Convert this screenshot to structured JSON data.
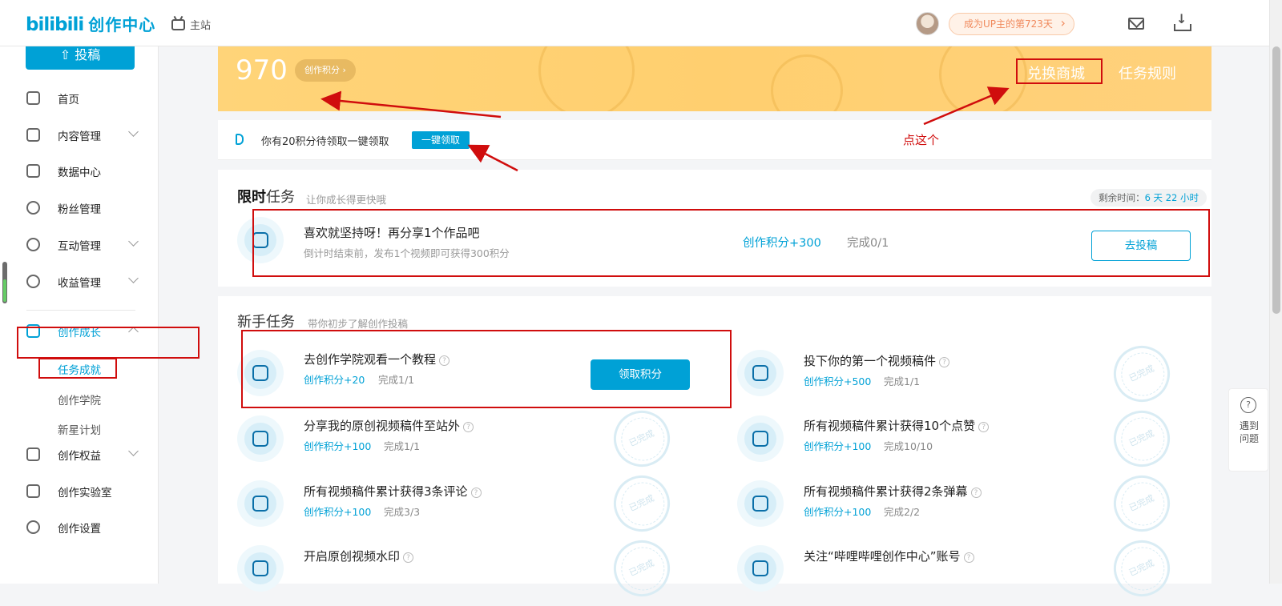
{
  "header": {
    "logo": "bilibili",
    "logo_sub": "创作中心",
    "main_site": "主站",
    "up_badge": "成为UP主的第723天"
  },
  "sidebar": {
    "upload": "投稿",
    "items": [
      {
        "label": "首页"
      },
      {
        "label": "内容管理"
      },
      {
        "label": "数据中心"
      },
      {
        "label": "粉丝管理"
      },
      {
        "label": "互动管理"
      },
      {
        "label": "收益管理"
      },
      {
        "label": "创作成长"
      },
      {
        "label": "创作权益"
      },
      {
        "label": "创作实验室"
      },
      {
        "label": "创作设置"
      }
    ],
    "sub_items": [
      {
        "label": "任务成就"
      },
      {
        "label": "创作学院"
      },
      {
        "label": "新星计划"
      }
    ]
  },
  "banner": {
    "score": "970",
    "score_pill": "创作积分 ›",
    "exchange": "兑换商城",
    "rules": "任务规则"
  },
  "notice": {
    "text": "你有20积分待领取一键领取",
    "button": "一键领取"
  },
  "limited": {
    "title_bold": "限时",
    "title_rest": "任务",
    "subtitle": "让你成长得更快哦",
    "remain_label": "剩余时间：",
    "remain_value": "6 天 22 小时",
    "task": {
      "title": "喜欢就坚持呀！再分享1个作品吧",
      "desc": "倒计时结束前，发布1个视频即可获得300积分",
      "points": "创作积分+300",
      "progress": "完成0/1",
      "button": "去投稿"
    }
  },
  "newbie": {
    "title": "新手任务",
    "subtitle": "带你初步了解创作投稿",
    "claim_button": "领取积分",
    "stamp": "已完成",
    "tasks": [
      {
        "title": "去创作学院观看一个教程",
        "points": "创作积分+20",
        "progress": "完成1/1"
      },
      {
        "title": "投下你的第一个视频稿件",
        "points": "创作积分+500",
        "progress": "完成1/1"
      },
      {
        "title": "分享我的原创视频稿件至站外",
        "points": "创作积分+100",
        "progress": "完成1/1"
      },
      {
        "title": "所有视频稿件累计获得10个点赞",
        "points": "创作积分+100",
        "progress": "完成10/10"
      },
      {
        "title": "所有视频稿件累计获得3条评论",
        "points": "创作积分+100",
        "progress": "完成3/3"
      },
      {
        "title": "所有视频稿件累计获得2条弹幕",
        "points": "创作积分+100",
        "progress": "完成2/2"
      },
      {
        "title": "开启原创视频水印",
        "points": "",
        "progress": ""
      },
      {
        "title": "关注“哔哩哔哩创作中心”账号",
        "points": "",
        "progress": ""
      }
    ]
  },
  "annotation": {
    "text": "点这个"
  },
  "help": {
    "q": "?",
    "text": "遇到问题"
  },
  "colors": {
    "accent": "#00a1d6",
    "banner": "#ffd479",
    "annotation": "#d00d0d"
  }
}
